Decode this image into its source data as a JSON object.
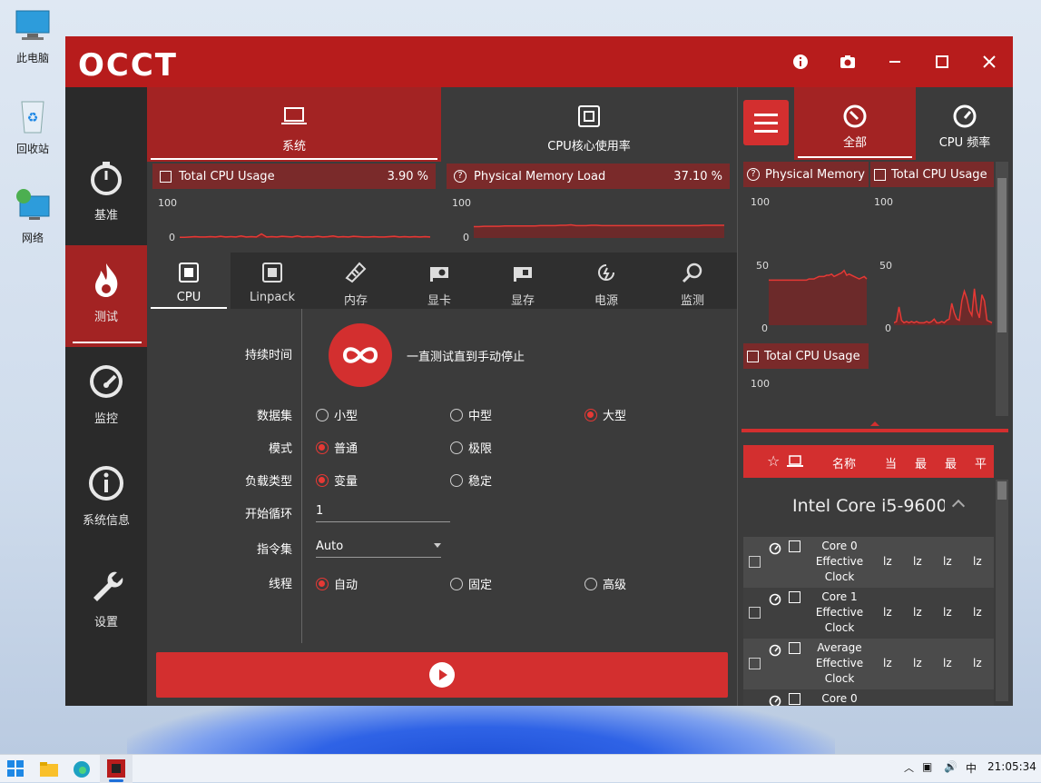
{
  "desktop": {
    "icons": [
      {
        "label": "此电脑",
        "icon": "this-pc-icon"
      },
      {
        "label": "回收站",
        "icon": "recycle-bin-icon"
      },
      {
        "label": "网络",
        "icon": "network-icon"
      }
    ]
  },
  "window": {
    "logo": "OCCT",
    "controls": {
      "info": "ⓘ",
      "screenshot": "camera",
      "minimize": "—",
      "maximize": "□",
      "close": "✕"
    }
  },
  "sidebar": {
    "items": [
      {
        "label": "基准",
        "icon": "stopwatch-icon",
        "active": false
      },
      {
        "label": "测试",
        "icon": "flame-icon",
        "active": true
      },
      {
        "label": "监控",
        "icon": "gauge-icon",
        "active": false
      },
      {
        "label": "系统信息",
        "icon": "info-icon",
        "active": false
      },
      {
        "label": "设置",
        "icon": "wrench-icon",
        "active": false
      }
    ]
  },
  "main": {
    "top_tabs": [
      {
        "label": "系统",
        "active": true
      },
      {
        "label": "CPU核心使用率",
        "active": false
      }
    ],
    "charts": [
      {
        "title": "Total CPU Usage",
        "value": "3.90 %",
        "ymax": "100",
        "ymin": "0",
        "series": [
          2,
          2,
          3,
          4,
          3,
          3,
          4,
          3,
          5,
          3,
          4,
          3,
          6,
          3,
          4,
          3,
          12,
          3,
          4,
          3,
          5,
          4,
          3,
          6,
          3,
          4,
          3,
          5,
          3,
          4,
          6,
          3,
          4,
          3,
          5,
          4,
          3,
          3,
          4,
          3,
          3,
          4,
          5,
          3,
          4,
          3,
          4,
          3,
          4,
          3
        ]
      },
      {
        "title": "Physical Memory Load",
        "value": "37.10 %",
        "ymax": "100",
        "ymin": "0",
        "series": [
          33,
          33,
          34,
          34,
          34,
          34,
          35,
          35,
          35,
          35,
          35,
          35,
          35,
          36,
          36,
          36,
          36,
          37,
          37,
          38,
          36,
          36,
          36,
          37,
          37,
          36,
          36,
          36,
          36,
          36,
          36,
          36,
          36,
          36,
          36,
          36,
          36,
          36,
          36,
          36,
          36,
          36,
          36,
          36,
          36,
          37,
          37,
          37,
          37,
          37
        ]
      }
    ],
    "sub_tabs": [
      {
        "label": "CPU",
        "icon": "chip-icon",
        "active": true
      },
      {
        "label": "Linpack",
        "icon": "chip-icon",
        "active": false
      },
      {
        "label": "内存",
        "icon": "ram-icon",
        "active": false
      },
      {
        "label": "显卡",
        "icon": "gpu-icon",
        "active": false
      },
      {
        "label": "显存",
        "icon": "vram-icon",
        "active": false
      },
      {
        "label": "电源",
        "icon": "power-icon",
        "active": false
      },
      {
        "label": "监测",
        "icon": "magnifier-icon",
        "active": false
      }
    ],
    "form": {
      "duration_label": "持续时间",
      "duration_text": "一直测试直到手动停止",
      "dataset_label": "数据集",
      "dataset_options": [
        {
          "label": "小型",
          "checked": false
        },
        {
          "label": "中型",
          "checked": false
        },
        {
          "label": "大型",
          "checked": true
        }
      ],
      "mode_label": "模式",
      "mode_options": [
        {
          "label": "普通",
          "checked": true
        },
        {
          "label": "极限",
          "checked": false
        }
      ],
      "load_label": "负载类型",
      "load_options": [
        {
          "label": "变量",
          "checked": true
        },
        {
          "label": "稳定",
          "checked": false
        }
      ],
      "cycle_label": "开始循环",
      "cycle_value": "1",
      "instr_label": "指令集",
      "instr_value": "Auto",
      "thread_label": "线程",
      "thread_options": [
        {
          "label": "自动",
          "checked": true
        },
        {
          "label": "固定",
          "checked": false
        },
        {
          "label": "高级",
          "checked": false
        }
      ]
    }
  },
  "right": {
    "tabs": [
      {
        "label": "全部",
        "active": true
      },
      {
        "label": "CPU 频率",
        "active": false
      }
    ],
    "mini_charts": [
      {
        "title": "Physical Memory",
        "ymax": "100",
        "ymid": "50",
        "ymin": "0",
        "series": [
          37,
          37,
          37,
          37,
          37,
          37,
          37,
          37,
          37,
          37,
          37,
          37,
          37,
          37,
          37,
          37,
          38,
          38,
          38,
          39,
          40,
          40,
          40,
          41,
          41,
          42,
          40,
          41,
          42,
          43,
          45,
          41,
          42,
          41,
          40,
          39,
          38,
          39,
          40,
          38
        ]
      },
      {
        "title": "Total CPU Usage",
        "ymax": "100",
        "ymid": "50",
        "ymin": "0",
        "series": [
          2,
          3,
          15,
          4,
          2,
          3,
          2,
          3,
          2,
          3,
          2,
          2,
          2,
          3,
          2,
          3,
          5,
          2,
          2,
          3,
          2,
          4,
          5,
          18,
          10,
          5,
          4,
          20,
          28,
          22,
          12,
          8,
          30,
          12,
          6,
          25,
          20,
          4,
          3,
          2
        ]
      },
      {
        "title": "Total CPU Usage",
        "ymax": "100"
      }
    ],
    "table": {
      "headers": [
        "名称",
        "当",
        "最",
        "最",
        "平"
      ],
      "cpu_name": "Intel Core i5-9600",
      "rows": [
        {
          "name": "Core 0 Effective Clock",
          "vals": [
            "lz",
            "lz",
            "lz",
            "lz"
          ]
        },
        {
          "name": "Core 1 Effective Clock",
          "vals": [
            "lz",
            "lz",
            "lz",
            "lz"
          ]
        },
        {
          "name": "Average Effective Clock",
          "vals": [
            "lz",
            "lz",
            "lz",
            "lz"
          ]
        },
        {
          "name": "Core 0",
          "vals": [
            "",
            "",
            "",
            ""
          ]
        }
      ]
    }
  },
  "taskbar": {
    "tray_ime": "中",
    "time": "21:05:34"
  },
  "colors": {
    "accent": "#d32f2f",
    "title": "#b71c1c",
    "panel": "#3b3b3b",
    "header": "#7a2a2a"
  }
}
